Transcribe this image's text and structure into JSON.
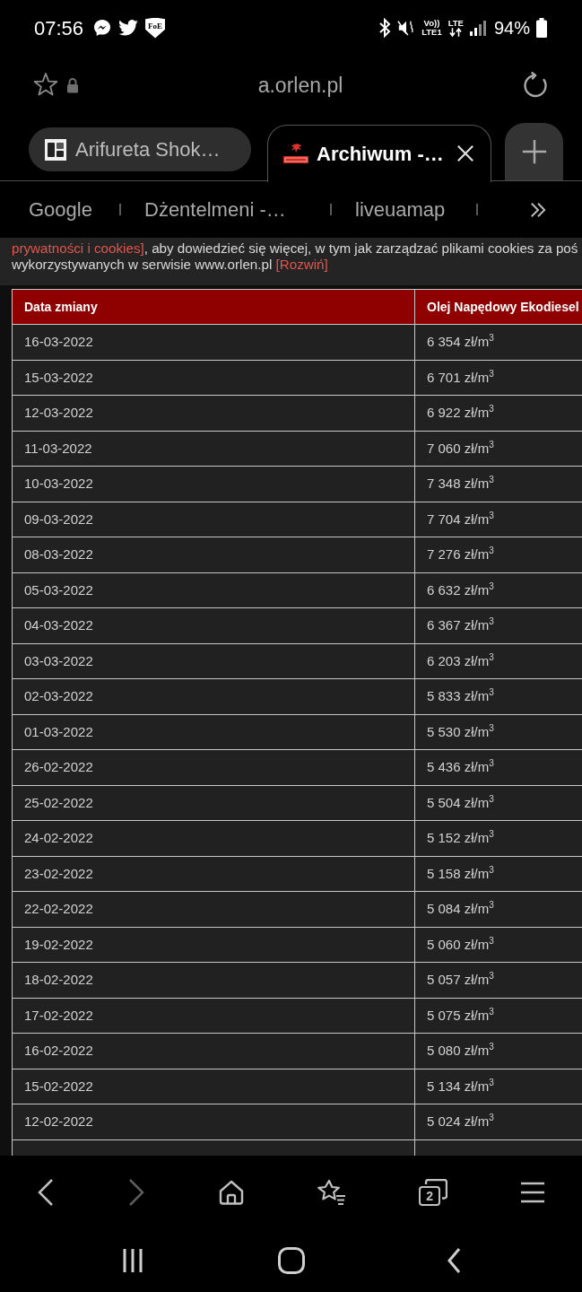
{
  "status_bar": {
    "time": "07:56",
    "shield_label": "FoE",
    "voice_label": "Vo))",
    "carrier_label": "LTE1",
    "data_label": "LTE",
    "battery": "94%"
  },
  "address_bar": {
    "url": "a.orlen.pl"
  },
  "tabs": [
    {
      "title": "Arifureta Shok…",
      "selected": false
    },
    {
      "title": "Archiwum -…",
      "selected": true
    }
  ],
  "bookmarks": [
    "Google",
    "Dżentelmeni -…",
    "liveuamap"
  ],
  "cookie_notice": {
    "lines": [
      [
        {
          "kind": "link",
          "text": "prywatności i cookies]"
        },
        {
          "kind": "text",
          "text": ", aby dowiedzieć się więcej, w tym jak zarządzać plikami cookies za poś"
        }
      ],
      [
        {
          "kind": "text",
          "text": "wykorzystywanych w serwisie www.orlen.pl "
        },
        {
          "kind": "link",
          "text": "[Rozwiń]"
        }
      ]
    ]
  },
  "table": {
    "columns": [
      "Data zmiany",
      "Olej Napędowy Ekodiesel"
    ],
    "rows": [
      {
        "date": "16-03-2022",
        "price": "6 354 zł/m$^{3}$"
      },
      {
        "date": "15-03-2022",
        "price": "6 701 zł/m$^{3}$"
      },
      {
        "date": "12-03-2022",
        "price": "6 922 zł/m$^{3}$"
      },
      {
        "date": "11-03-2022",
        "price": "7 060 zł/m$^{3}$"
      },
      {
        "date": "10-03-2022",
        "price": "7 348 zł/m$^{3}$"
      },
      {
        "date": "09-03-2022",
        "price": "7 704 zł/m$^{3}$"
      },
      {
        "date": "08-03-2022",
        "price": "7 276 zł/m$^{3}$"
      },
      {
        "date": "05-03-2022",
        "price": "6 632 zł/m$^{3}$"
      },
      {
        "date": "04-03-2022",
        "price": "6 367 zł/m$^{3}$"
      },
      {
        "date": "03-03-2022",
        "price": "6 203 zł/m$^{3}$"
      },
      {
        "date": "02-03-2022",
        "price": "5 833 zł/m$^{3}$"
      },
      {
        "date": "01-03-2022",
        "price": "5 530 zł/m$^{3}$"
      },
      {
        "date": "26-02-2022",
        "price": "5 436 zł/m$^{3}$"
      },
      {
        "date": "25-02-2022",
        "price": "5 504 zł/m$^{3}$"
      },
      {
        "date": "24-02-2022",
        "price": "5 152 zł/m$^{3}$"
      },
      {
        "date": "23-02-2022",
        "price": "5 158 zł/m$^{3}$"
      },
      {
        "date": "22-02-2022",
        "price": "5 084 zł/m$^{3}$"
      },
      {
        "date": "19-02-2022",
        "price": "5 060 zł/m$^{3}$"
      },
      {
        "date": "18-02-2022",
        "price": "5 057 zł/m$^{3}$"
      },
      {
        "date": "17-02-2022",
        "price": "5 075 zł/m$^{3}$"
      },
      {
        "date": "16-02-2022",
        "price": "5 080 zł/m$^{3}$"
      },
      {
        "date": "15-02-2022",
        "price": "5 134 zł/m$^{3}$"
      },
      {
        "date": "12-02-2022",
        "price": "5 024 zł/m$^{3}$"
      }
    ]
  },
  "bottom_toolbar": {
    "back": {
      "disabled": false
    },
    "forward": {
      "disabled": true
    },
    "tab_count": "2"
  }
}
